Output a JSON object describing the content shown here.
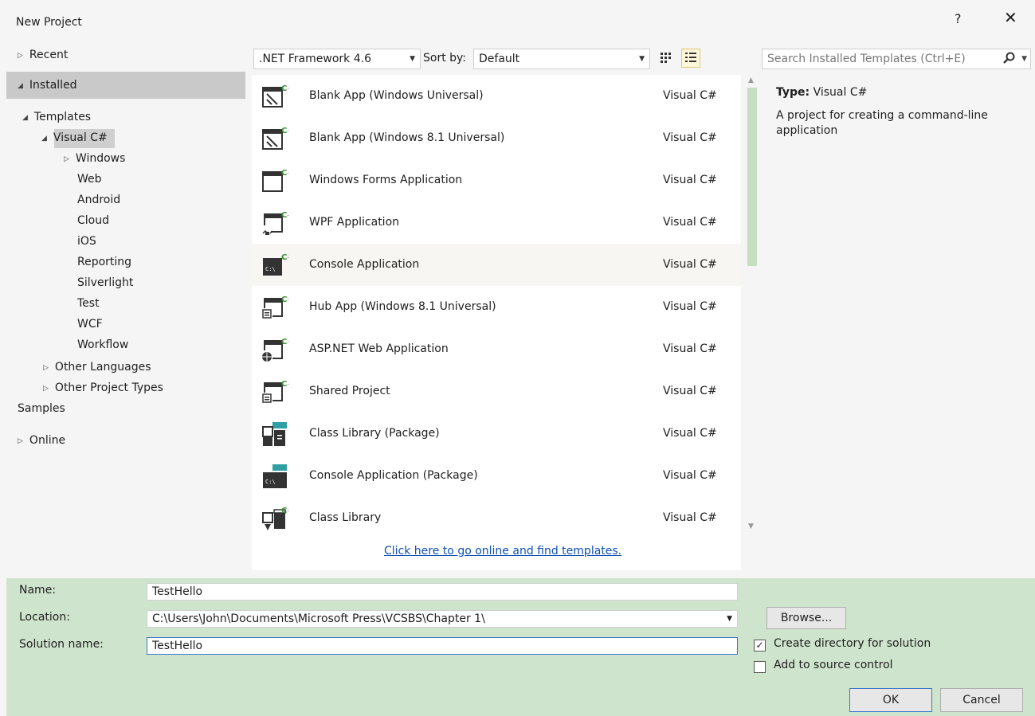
{
  "window": {
    "title": "New Project",
    "help_label": "?",
    "close_label": "✕"
  },
  "tree": {
    "recent": "Recent",
    "installed": "Installed",
    "templates": "Templates",
    "visual_csharp": "Visual C#",
    "windows": "Windows",
    "children": [
      "Web",
      "Android",
      "Cloud",
      "iOS",
      "Reporting",
      "Silverlight",
      "Test",
      "WCF",
      "Workflow"
    ],
    "other_languages": "Other Languages",
    "other_project_types": "Other Project Types",
    "samples": "Samples",
    "online": "Online"
  },
  "toolbar": {
    "framework": ".NET Framework 4.6",
    "sort_label": "Sort by:",
    "sort_value": "Default"
  },
  "search": {
    "placeholder": "Search Installed Templates (Ctrl+E)"
  },
  "templates": [
    {
      "name": "Blank App (Windows Universal)",
      "type": "Visual C#",
      "icon": "universal-app-icon"
    },
    {
      "name": "Blank App (Windows 8.1 Universal)",
      "type": "Visual C#",
      "icon": "universal-app-icon"
    },
    {
      "name": "Windows Forms Application",
      "type": "Visual C#",
      "icon": "window-form-icon"
    },
    {
      "name": "WPF Application",
      "type": "Visual C#",
      "icon": "wpf-icon"
    },
    {
      "name": "Console Application",
      "type": "Visual C#",
      "icon": "console-icon"
    },
    {
      "name": "Hub App (Windows 8.1 Universal)",
      "type": "Visual C#",
      "icon": "hub-app-icon"
    },
    {
      "name": "ASP.NET Web Application",
      "type": "Visual C#",
      "icon": "web-globe-icon"
    },
    {
      "name": "Shared Project",
      "type": "Visual C#",
      "icon": "shared-project-icon"
    },
    {
      "name": "Class Library (Package)",
      "type": "Visual C#",
      "icon": "package-library-icon"
    },
    {
      "name": "Console Application (Package)",
      "type": "Visual C#",
      "icon": "package-console-icon"
    },
    {
      "name": "Class Library",
      "type": "Visual C#",
      "icon": "class-library-icon"
    }
  ],
  "online_link": "Click here to go online and find templates.",
  "details": {
    "type_label": "Type:",
    "type_value": "Visual C#",
    "description": "A project for creating a command-line application"
  },
  "form": {
    "name_label": "Name:",
    "name_value": "TestHello",
    "location_label": "Location:",
    "location_value": "C:\\Users\\John\\Documents\\Microsoft Press\\VCSBS\\Chapter 1\\",
    "solution_label": "Solution name:",
    "solution_value": "TestHello",
    "browse": "Browse...",
    "create_dir": "Create directory for solution",
    "create_dir_checked": true,
    "source_control": "Add to source control",
    "source_control_checked": false,
    "ok": "OK",
    "cancel": "Cancel"
  },
  "colors": {
    "accent_green": "#68217a",
    "csharp_green": "#388a34",
    "selection": "#c9c9c9",
    "footer": "#cfe4cd"
  }
}
